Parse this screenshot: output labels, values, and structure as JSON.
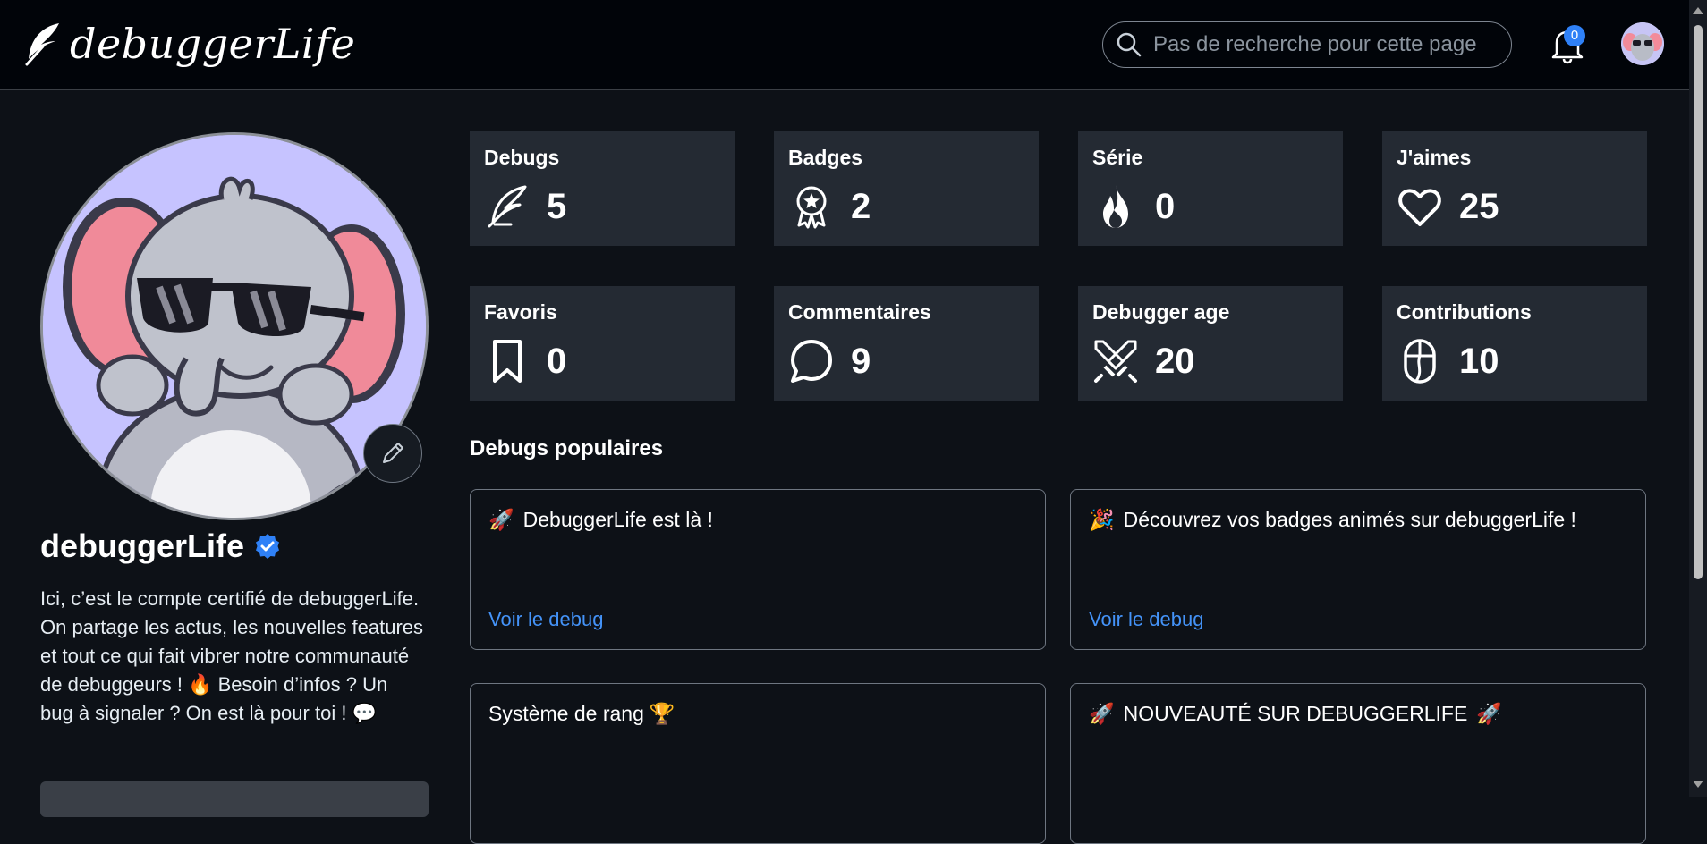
{
  "header": {
    "logo_text": "debuggerLife",
    "search_placeholder": "Pas de recherche pour cette page",
    "notification_count": "0"
  },
  "profile": {
    "name": "debuggerLife",
    "bio": "Ici, c’est le compte certifié de debuggerLife. On partage les actus, les nouvelles features et tout ce qui fait vibrer notre communauté de debuggeurs ! 🔥 Besoin d’infos ? Un bug à signaler ? On est là pour toi ! 💬"
  },
  "stats": [
    {
      "label": "Debugs",
      "value": "5",
      "icon": "feather-icon"
    },
    {
      "label": "Badges",
      "value": "2",
      "icon": "award-icon"
    },
    {
      "label": "Série",
      "value": "0",
      "icon": "flame-icon"
    },
    {
      "label": "J'aimes",
      "value": "25",
      "icon": "heart-icon"
    },
    {
      "label": "Favoris",
      "value": "0",
      "icon": "bookmark-icon"
    },
    {
      "label": "Commentaires",
      "value": "9",
      "icon": "comment-icon"
    },
    {
      "label": "Debugger age",
      "value": "20",
      "icon": "crossed-swords-icon"
    },
    {
      "label": "Contributions",
      "value": "10",
      "icon": "mouse-icon"
    }
  ],
  "popular": {
    "title": "Debugs populaires",
    "items": [
      {
        "title": "DebuggerLife est là !",
        "emoji": "🚀",
        "link": "Voir le debug"
      },
      {
        "title": "Découvrez vos badges animés sur debuggerLife !",
        "emoji": "🎉",
        "link": "Voir le debug"
      },
      {
        "title": "Système de rang",
        "emoji_after": "🏆",
        "link": ""
      },
      {
        "title": "NOUVEAUTÉ SUR DEBUGGERLIFE",
        "emoji": "🚀",
        "emoji_after": "🚀",
        "link": ""
      }
    ]
  },
  "colors": {
    "background": "#0d1117",
    "card": "#242a33",
    "accent": "#2f81f7",
    "link": "#4493f8"
  }
}
